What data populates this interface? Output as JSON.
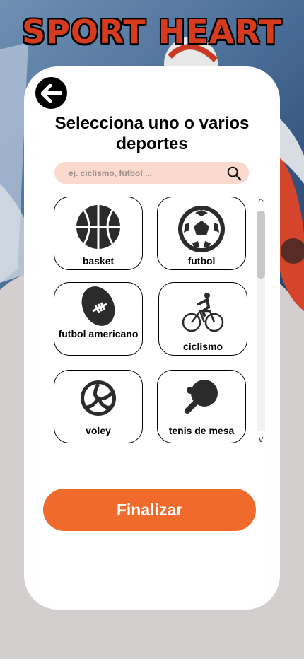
{
  "app": {
    "brand_title": "SPORT HEART"
  },
  "header": {
    "title": "Selecciona uno o varios deportes"
  },
  "search": {
    "placeholder": "ej. ciclismo, fútbol ..."
  },
  "sports": [
    {
      "label": "basket",
      "icon": "basketball-icon"
    },
    {
      "label": "futbol",
      "icon": "soccer-ball-icon"
    },
    {
      "label": "futbol americano",
      "icon": "american-football-icon"
    },
    {
      "label": "ciclismo",
      "icon": "cyclist-icon"
    },
    {
      "label": "voley",
      "icon": "volleyball-icon"
    },
    {
      "label": "tenis de mesa",
      "icon": "ping-pong-paddle-icon"
    }
  ],
  "scroll": {
    "up": "^",
    "down": "v"
  },
  "actions": {
    "finish_label": "Finalizar"
  },
  "colors": {
    "accent": "#ef6a2b",
    "search_bg": "#fbd9cc",
    "brand": "#d63a1f",
    "backdrop": "#d3cfcf"
  }
}
